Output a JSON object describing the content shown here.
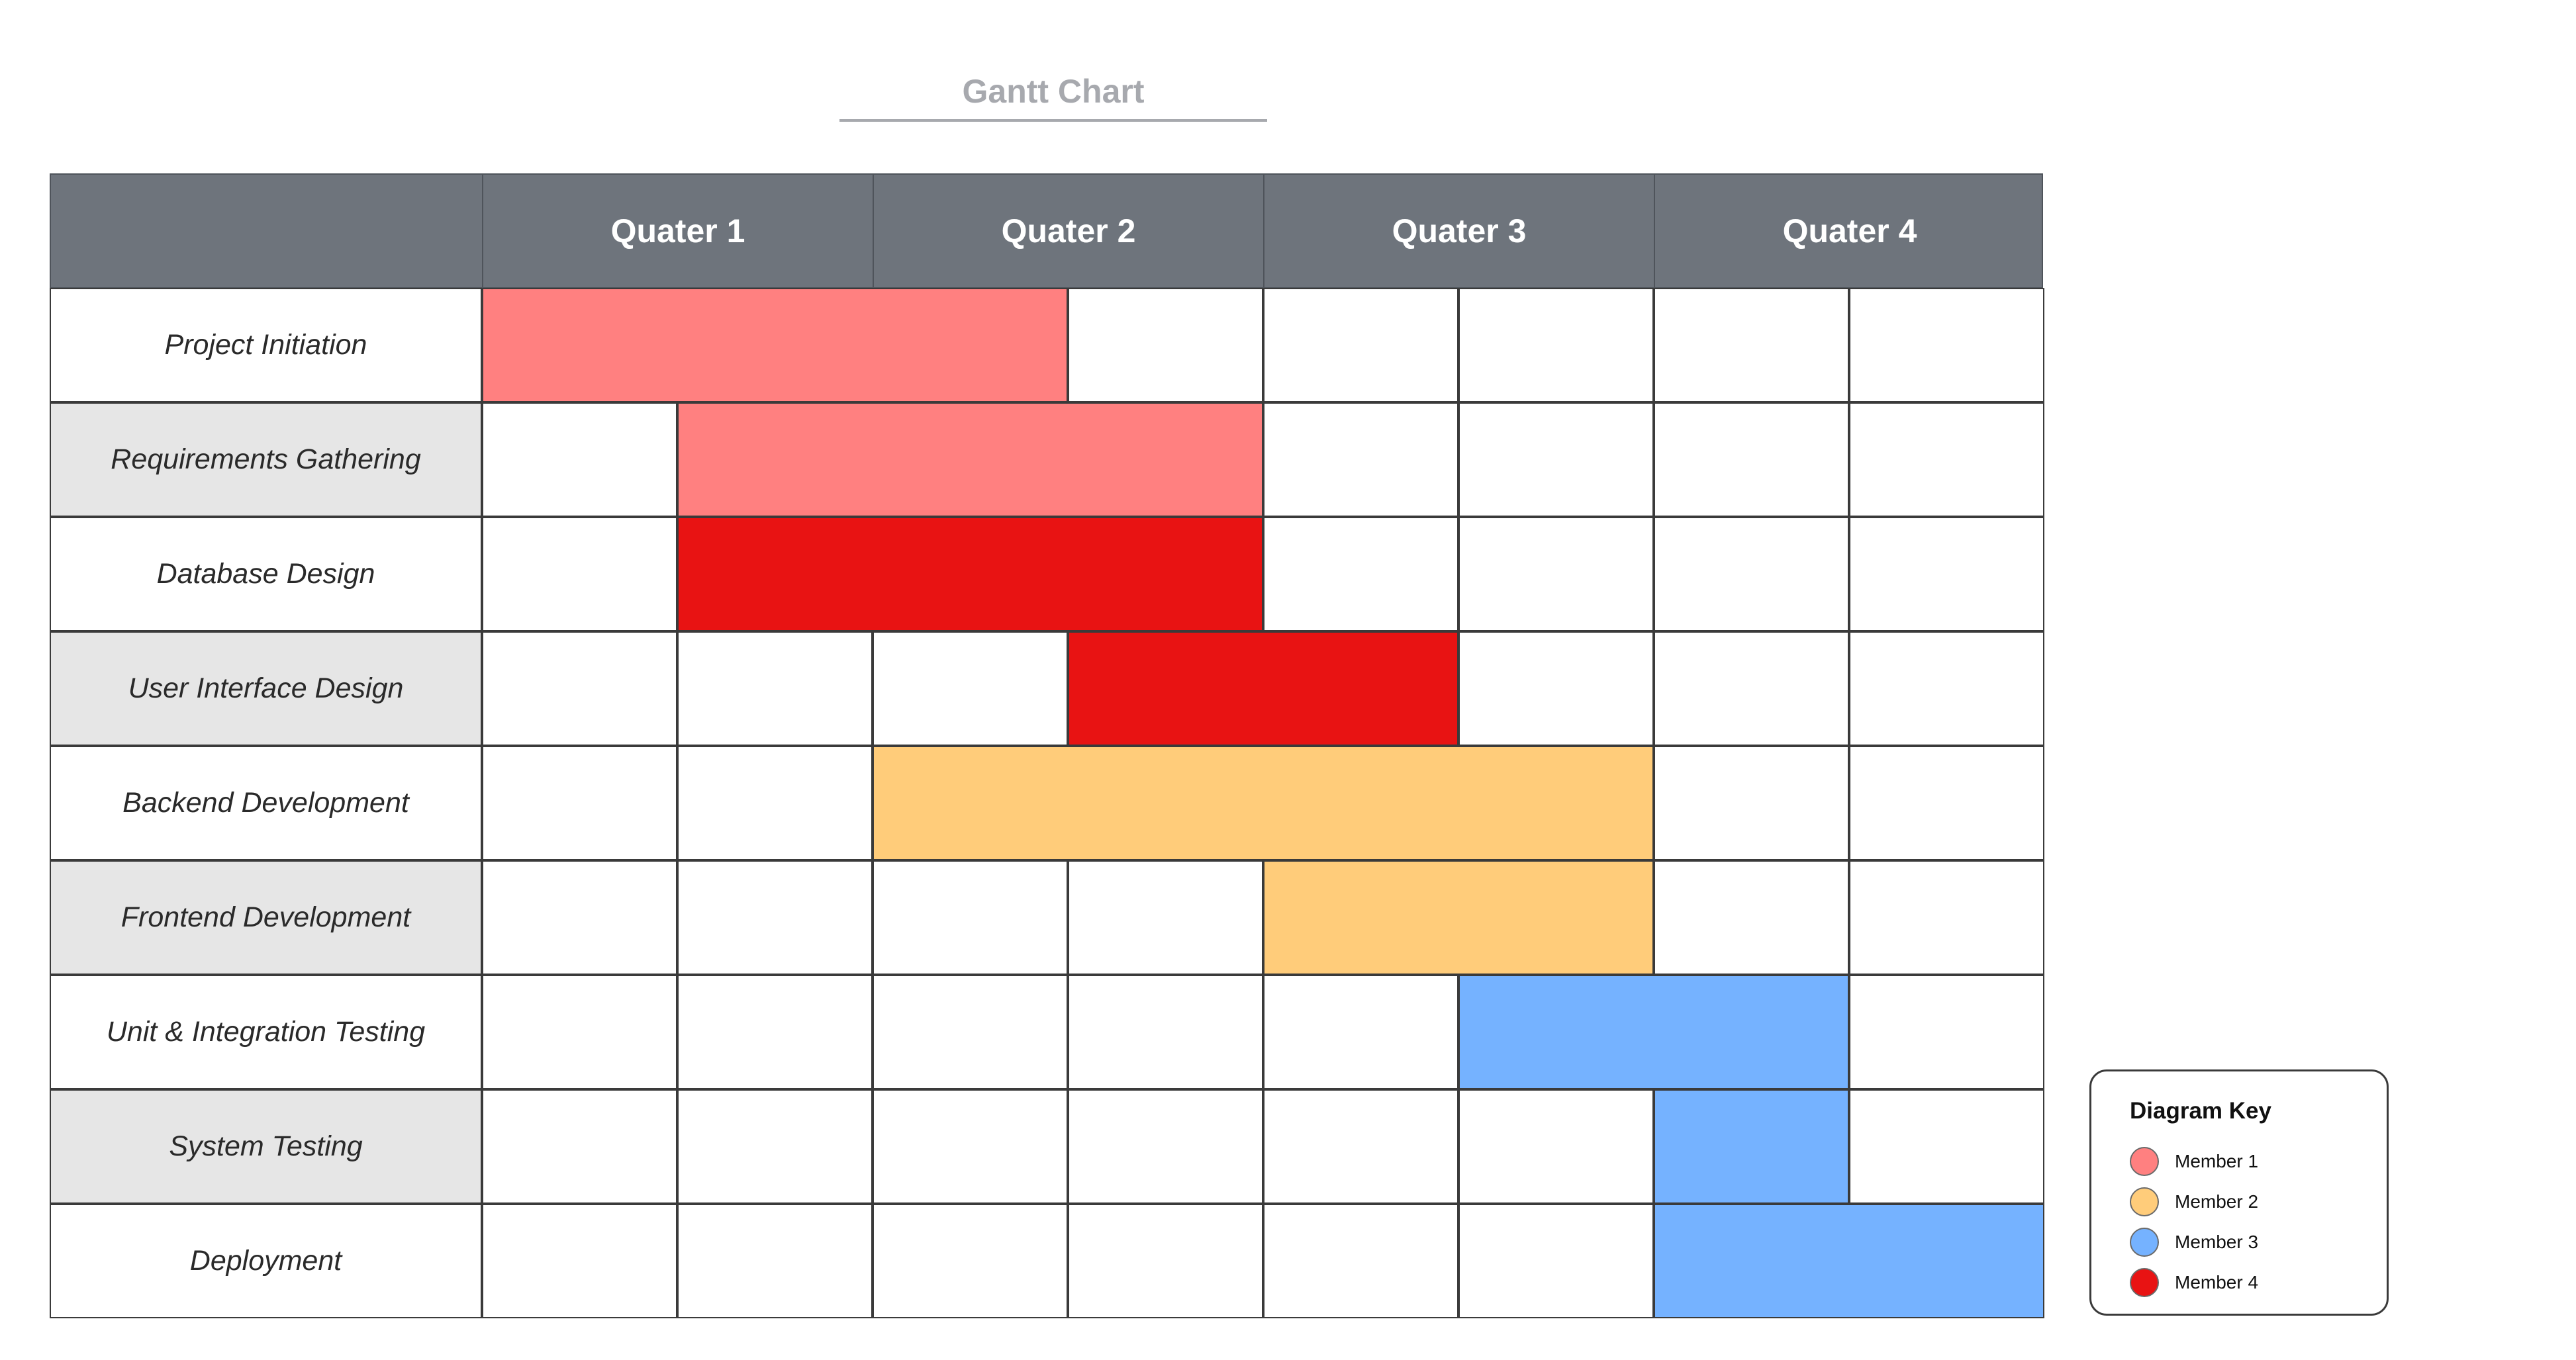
{
  "title": "Gantt Chart",
  "quarters": [
    "Quater 1",
    "Quater 2",
    "Quater 3",
    "Quater 4"
  ],
  "tasks": [
    {
      "label": "Project Initiation",
      "start": 0,
      "end": 3,
      "member": 0
    },
    {
      "label": "Requirements Gathering",
      "start": 1,
      "end": 4,
      "member": 0
    },
    {
      "label": "Database Design",
      "start": 1,
      "end": 4,
      "member": 3
    },
    {
      "label": "User Interface Design",
      "start": 3,
      "end": 5,
      "member": 3
    },
    {
      "label": "Backend Development",
      "start": 2,
      "end": 6,
      "member": 1
    },
    {
      "label": "Frontend Development",
      "start": 4,
      "end": 6,
      "member": 1
    },
    {
      "label": "Unit & Integration Testing",
      "start": 5,
      "end": 7,
      "member": 2
    },
    {
      "label": "System Testing",
      "start": 6,
      "end": 7,
      "member": 2
    },
    {
      "label": "Deployment",
      "start": 6,
      "end": 8,
      "member": 2
    }
  ],
  "legend": {
    "title": "Diagram Key",
    "members": [
      {
        "label": "Member 1",
        "color": "#ff8080"
      },
      {
        "label": "Member 2",
        "color": "#ffcc7a"
      },
      {
        "label": "Member 3",
        "color": "#75b2ff"
      },
      {
        "label": "Member 4",
        "color": "#e81313"
      }
    ]
  },
  "colors": {
    "header": "#6e747c",
    "title": "#a7a9ae",
    "row_alt": "#e6e6e6"
  }
}
